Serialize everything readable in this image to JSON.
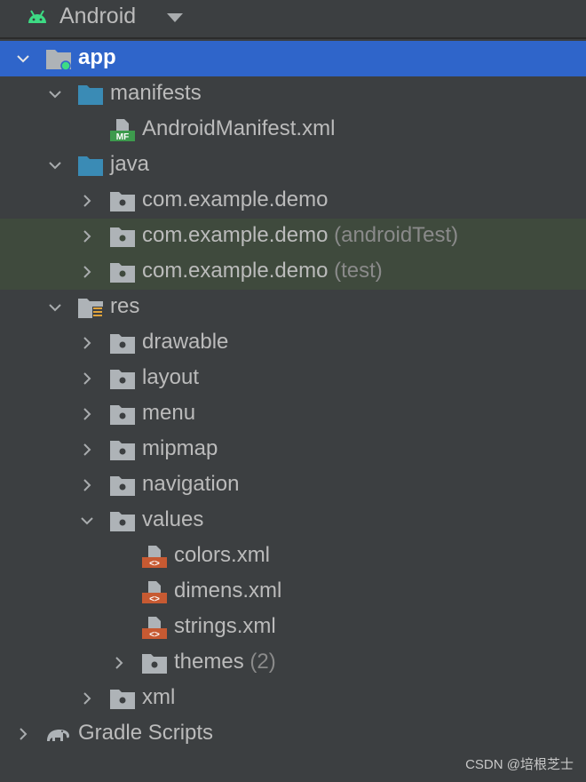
{
  "header": {
    "title": "Android"
  },
  "tree": [
    {
      "label": "app",
      "suffix": ""
    },
    {
      "label": "manifests",
      "suffix": ""
    },
    {
      "label": "AndroidManifest.xml",
      "suffix": "",
      "badge": "MF"
    },
    {
      "label": "java",
      "suffix": ""
    },
    {
      "label": "com.example.demo",
      "suffix": ""
    },
    {
      "label": "com.example.demo",
      "suffix": "(androidTest)"
    },
    {
      "label": "com.example.demo",
      "suffix": "(test)"
    },
    {
      "label": "res",
      "suffix": ""
    },
    {
      "label": "drawable",
      "suffix": ""
    },
    {
      "label": "layout",
      "suffix": ""
    },
    {
      "label": "menu",
      "suffix": ""
    },
    {
      "label": "mipmap",
      "suffix": ""
    },
    {
      "label": "navigation",
      "suffix": ""
    },
    {
      "label": "values",
      "suffix": ""
    },
    {
      "label": "colors.xml",
      "suffix": "",
      "badge": "<>"
    },
    {
      "label": "dimens.xml",
      "suffix": "",
      "badge": "<>"
    },
    {
      "label": "strings.xml",
      "suffix": "",
      "badge": "<>"
    },
    {
      "label": "themes",
      "suffix": "(2)"
    },
    {
      "label": "xml",
      "suffix": ""
    },
    {
      "label": "Gradle Scripts",
      "suffix": ""
    }
  ],
  "watermark": "CSDN @培根芝士",
  "colors": {
    "selected": "#2f65ca",
    "highlight": "#3f4a3d",
    "folder_blue": "#3a8bb5",
    "folder_gray": "#aeb3b7",
    "xml_orange": "#c75a32",
    "manifest_green": "#3d9a4d",
    "android_green": "#3ddc84"
  }
}
